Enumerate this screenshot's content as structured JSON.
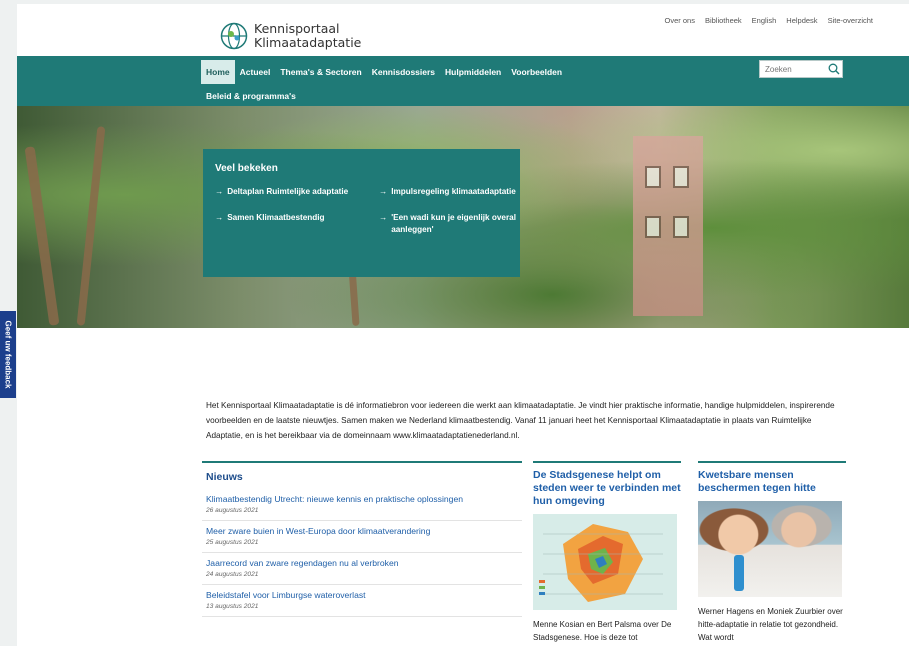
{
  "header": {
    "logo_line1": "Kennisportaal",
    "logo_line2": "Klimaatadaptatie",
    "utility_links": [
      "Over ons",
      "Bibliotheek",
      "English",
      "Helpdesk",
      "Site-overzicht"
    ]
  },
  "nav": {
    "items": [
      "Home",
      "Actueel",
      "Thema's & Sectoren",
      "Kennisdossiers",
      "Hulpmiddelen",
      "Voorbeelden"
    ],
    "second_row": "Beleid & programma's",
    "active": "Home",
    "search_placeholder": "Zoeken"
  },
  "veel_bekeken": {
    "title": "Veel bekeken",
    "links": [
      "Deltaplan Ruimtelijke adaptatie",
      "Impulsregeling klimaatadaptatie",
      "Samen Klimaatbestendig",
      "'Een wadi kun je eigenlijk overal aanleggen'"
    ]
  },
  "feedback_label": "Geef uw feedback",
  "intro": "Het Kennisportaal Klimaatadaptatie is dé informatiebron voor iedereen die werkt aan klimaatadaptatie. Je vindt hier praktische informatie, handige hulpmiddelen, inspirerende voorbeelden en de laatste nieuwtjes. Samen maken we Nederland klimaatbestendig. Vanaf 11 januari heet het Kennisportaal Klimaatadaptatie in plaats van Ruimtelijke Adaptatie, en is het bereikbaar via de domeinnaam www.klimaatadaptatienederland.nl.",
  "news": {
    "heading": "Nieuws",
    "items": [
      {
        "title": "Klimaatbestendig Utrecht: nieuwe kennis en praktische oplossingen",
        "date": "26 augustus 2021"
      },
      {
        "title": "Meer zware buien in West-Europa door klimaatverandering",
        "date": "25 augustus 2021"
      },
      {
        "title": "Jaarrecord van zware regendagen nu al verbroken",
        "date": "24 augustus 2021"
      },
      {
        "title": "Beleidstafel voor Limburgse wateroverlast",
        "date": "13 augustus 2021"
      }
    ]
  },
  "features": [
    {
      "title": "De Stadsgenese helpt om steden weer te verbinden met hun omgeving",
      "text": "Menne Kosian en Bert Palsma over De Stadsgenese. Hoe is deze tot"
    },
    {
      "title": "Kwetsbare mensen beschermen tegen hitte",
      "text": "Werner Hagens en Moniek Zuurbier over hitte-adaptatie in relatie tot gezondheid. Wat wordt"
    }
  ],
  "colors": {
    "teal": "#1f7a77",
    "link_blue": "#1f5fa8",
    "feedback_blue": "#1c3f8c"
  },
  "icons": [
    "logo-globe-icon",
    "search-icon",
    "arrow-right-icon"
  ]
}
